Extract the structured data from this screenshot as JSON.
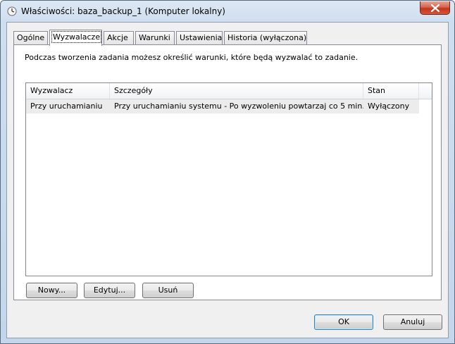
{
  "window": {
    "title": "Właściwości: baza_backup_1 (Komputer lokalny)"
  },
  "tabs": [
    {
      "label": "Ogólne"
    },
    {
      "label": "Wyzwalacze"
    },
    {
      "label": "Akcje"
    },
    {
      "label": "Warunki"
    },
    {
      "label": "Ustawienia"
    },
    {
      "label": "Historia (wyłączona)"
    }
  ],
  "active_tab": "Wyzwalacze",
  "panel": {
    "description": "Podczas tworzenia zadania możesz określić warunki, które będą wyzwalać to zadanie."
  },
  "list": {
    "columns": [
      "Wyzwalacz",
      "Szczegóły",
      "Stan"
    ],
    "rows": [
      [
        "Przy uruchamianiu",
        "Przy uruchamianiu systemu - Po wyzwoleniu powtarzaj co 5 min...",
        "Wyłączony"
      ]
    ]
  },
  "buttons": {
    "new_label": "Nowy...",
    "edit_label": "Edytuj...",
    "delete_label": "Usuń",
    "ok_label": "OK",
    "cancel_label": "Anuluj"
  },
  "icons": {
    "title": "clock-icon",
    "close": "close-icon"
  },
  "colors": {
    "close_button": "#c2351d",
    "default_button_border": "#3c7fb1",
    "selected_row": "#ececec"
  }
}
